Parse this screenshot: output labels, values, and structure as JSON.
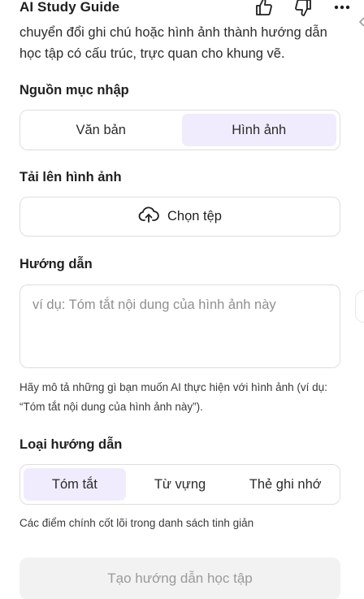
{
  "header": {
    "title": "AI Study Guide",
    "icons": [
      "thumbs-up-icon",
      "thumbs-down-icon",
      "more-options-icon"
    ]
  },
  "intro": "chuyển đổi ghi chú hoặc hình ảnh thành hướng dẫn học tập có cấu trúc, trực quan cho khung vẽ.",
  "source": {
    "label": "Nguồn mục nhập",
    "options": [
      "Văn bản",
      "Hình ảnh"
    ],
    "selected": "Hình ảnh"
  },
  "upload": {
    "label": "Tải lên hình ảnh",
    "button": "Chọn tệp",
    "icon": "cloud-upload-icon"
  },
  "instructions": {
    "label": "Hướng dẫn",
    "placeholder": "ví dụ: Tóm tắt nội dung của hình ảnh này",
    "value": "",
    "help": "Hãy mô tả những gì bạn muốn AI thực hiện với hình ảnh (ví dụ: “Tóm tắt nội dung của hình ảnh này”)."
  },
  "guide_type": {
    "label": "Loại hướng dẫn",
    "options": [
      "Tóm tắt",
      "Từ vựng",
      "Thẻ ghi nhớ"
    ],
    "selected": "Tóm tắt",
    "description": "Các điểm chính cốt lõi trong danh sách tinh giản"
  },
  "submit": {
    "label": "Tạo hướng dẫn học tập",
    "disabled": true
  },
  "colors": {
    "accent_bg": "#f0ecfd",
    "border": "#dedede",
    "disabled_bg": "#f2f2f2",
    "disabled_text": "#9a9a9a"
  }
}
